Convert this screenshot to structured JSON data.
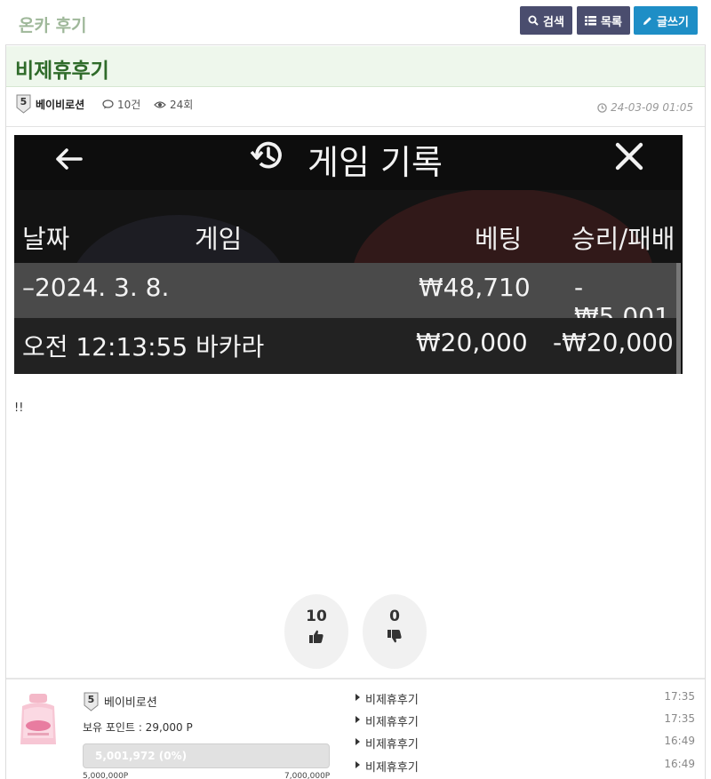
{
  "board": {
    "title": "온카 후기"
  },
  "buttons": {
    "search": "검색",
    "list": "목록",
    "write": "글쓰기"
  },
  "post": {
    "subject": "비제휴후기",
    "author": "베이비로션",
    "author_level": "5",
    "comments": "10건",
    "views": "24회",
    "date": "24-03-09 01:05",
    "body": "!!"
  },
  "screenshot": {
    "title": "게임 기록",
    "columns": [
      "날짜",
      "게임",
      "베팅",
      "승리/패배"
    ],
    "rows": [
      {
        "date": "–2024. 3. 8.",
        "game": "",
        "bet": "₩48,710",
        "result": "-₩5,001"
      },
      {
        "date": "오전 12:13:55",
        "game": "바카라",
        "bet": "₩20,000",
        "result": "-₩20,000"
      }
    ]
  },
  "votes": {
    "good": "10",
    "bad": "0"
  },
  "profile": {
    "name": "베이비로션",
    "level": "5",
    "points": "보유 포인트 : 29,000 P",
    "progress_label": "5,001,972 (0%)",
    "progress_fraction": 0,
    "min": "5,000,000P",
    "max": "7,000,000P"
  },
  "recent_posts": [
    {
      "title": "비제휴후기",
      "time": "17:35"
    },
    {
      "title": "비제휴후기",
      "time": "17:35"
    },
    {
      "title": "비제휴후기",
      "time": "16:49"
    },
    {
      "title": "비제휴후기",
      "time": "16:49"
    }
  ],
  "colors": {
    "accent_green": "#2f6b2a",
    "button_dark": "#4a4d6e",
    "button_blue": "#1e8ec6"
  }
}
